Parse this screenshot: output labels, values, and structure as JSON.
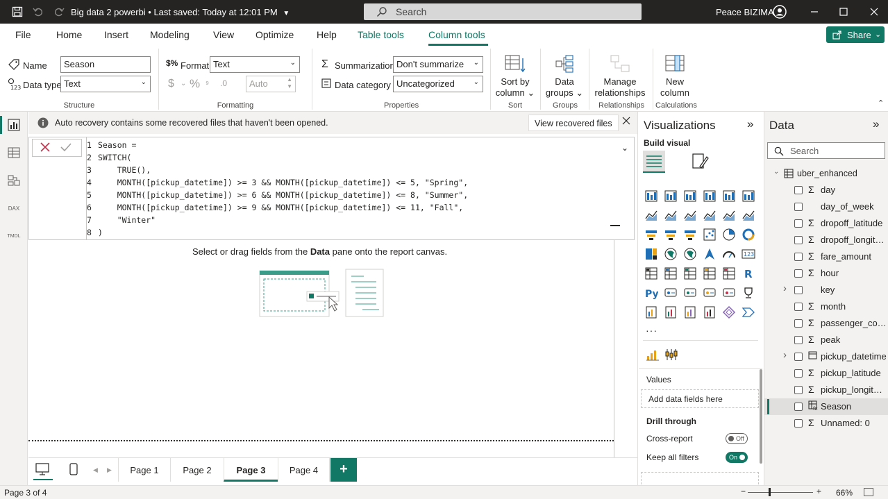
{
  "title_bar": {
    "file_title": "Big data 2 powerbi • Last saved: Today at 12:01 PM",
    "search_placeholder": "Search",
    "user_name": "Peace BIZIMA"
  },
  "menu": {
    "items": [
      "File",
      "Home",
      "Insert",
      "Modeling",
      "View",
      "Optimize",
      "Help",
      "Table tools",
      "Column tools"
    ],
    "share_label": "Share"
  },
  "ribbon": {
    "structure": {
      "name_label": "Name",
      "name_value": "Season",
      "datatype_label": "Data type",
      "datatype_value": "Text",
      "group": "Structure"
    },
    "formatting": {
      "format_label": "Format",
      "format_value": "Text",
      "currency": "$",
      "percent": "%",
      "auto_value": "Auto",
      "group": "Formatting"
    },
    "properties": {
      "summarization_label": "Summarization",
      "summarization_value": "Don't summarize",
      "category_label": "Data category",
      "category_value": "Uncategorized",
      "group": "Properties"
    },
    "sort": {
      "label_1": "Sort by",
      "label_2": "column",
      "group": "Sort"
    },
    "groups": {
      "label_1": "Data",
      "label_2": "groups",
      "group": "Groups"
    },
    "relationships": {
      "label_1": "Manage",
      "label_2": "relationships",
      "group": "Relationships"
    },
    "calculations": {
      "label_1": "New",
      "label_2": "column",
      "group": "Calculations"
    }
  },
  "banner": {
    "message": "Auto recovery contains some recovered files that haven't been opened.",
    "button": "View recovered files"
  },
  "formula": {
    "lines": [
      {
        "n": "1",
        "t": "Season ="
      },
      {
        "n": "2",
        "t": "SWITCH("
      },
      {
        "n": "3",
        "t": "    TRUE(),"
      },
      {
        "n": "4",
        "t": "    MONTH([pickup_datetime]) >= 3 && MONTH([pickup_datetime]) <= 5, \"Spring\","
      },
      {
        "n": "5",
        "t": "    MONTH([pickup_datetime]) >= 6 && MONTH([pickup_datetime]) <= 8, \"Summer\","
      },
      {
        "n": "6",
        "t": "    MONTH([pickup_datetime]) >= 9 && MONTH([pickup_datetime]) <= 11, \"Fall\","
      },
      {
        "n": "7",
        "t": "    \"Winter\""
      },
      {
        "n": "8",
        "t": ")"
      }
    ]
  },
  "canvas": {
    "hint_prefix": "Select or drag fields from the ",
    "hint_bold": "Data",
    "hint_suffix": " pane onto the report canvas."
  },
  "pages": [
    "Page 1",
    "Page 2",
    "Page 3",
    "Page 4"
  ],
  "status": {
    "page_info": "Page 3 of 4",
    "zoom": "66%"
  },
  "visualizations": {
    "title": "Visualizations",
    "build_visual": "Build visual",
    "values_label": "Values",
    "add_fields": "Add data fields here",
    "drill_through": "Drill through",
    "cross_report": "Cross-report",
    "cross_report_state": "Off",
    "keep_filters": "Keep all filters",
    "keep_filters_state": "On"
  },
  "data_pane": {
    "title": "Data",
    "search_placeholder": "Search",
    "table": "uber_enhanced",
    "fields": [
      {
        "name": "day",
        "type": "sum"
      },
      {
        "name": "day_of_week",
        "type": "text"
      },
      {
        "name": "dropoff_latitude",
        "type": "sum"
      },
      {
        "name": "dropoff_longitu...",
        "type": "sum"
      },
      {
        "name": "fare_amount",
        "type": "sum"
      },
      {
        "name": "hour",
        "type": "sum"
      },
      {
        "name": "key",
        "type": "expand"
      },
      {
        "name": "month",
        "type": "sum"
      },
      {
        "name": "passenger_count",
        "type": "sum"
      },
      {
        "name": "peak",
        "type": "sum"
      },
      {
        "name": "pickup_datetime",
        "type": "date"
      },
      {
        "name": "pickup_latitude",
        "type": "sum"
      },
      {
        "name": "pickup_longitude",
        "type": "sum"
      },
      {
        "name": "Season",
        "type": "calc"
      },
      {
        "name": "Unnamed: 0",
        "type": "sum"
      }
    ]
  }
}
